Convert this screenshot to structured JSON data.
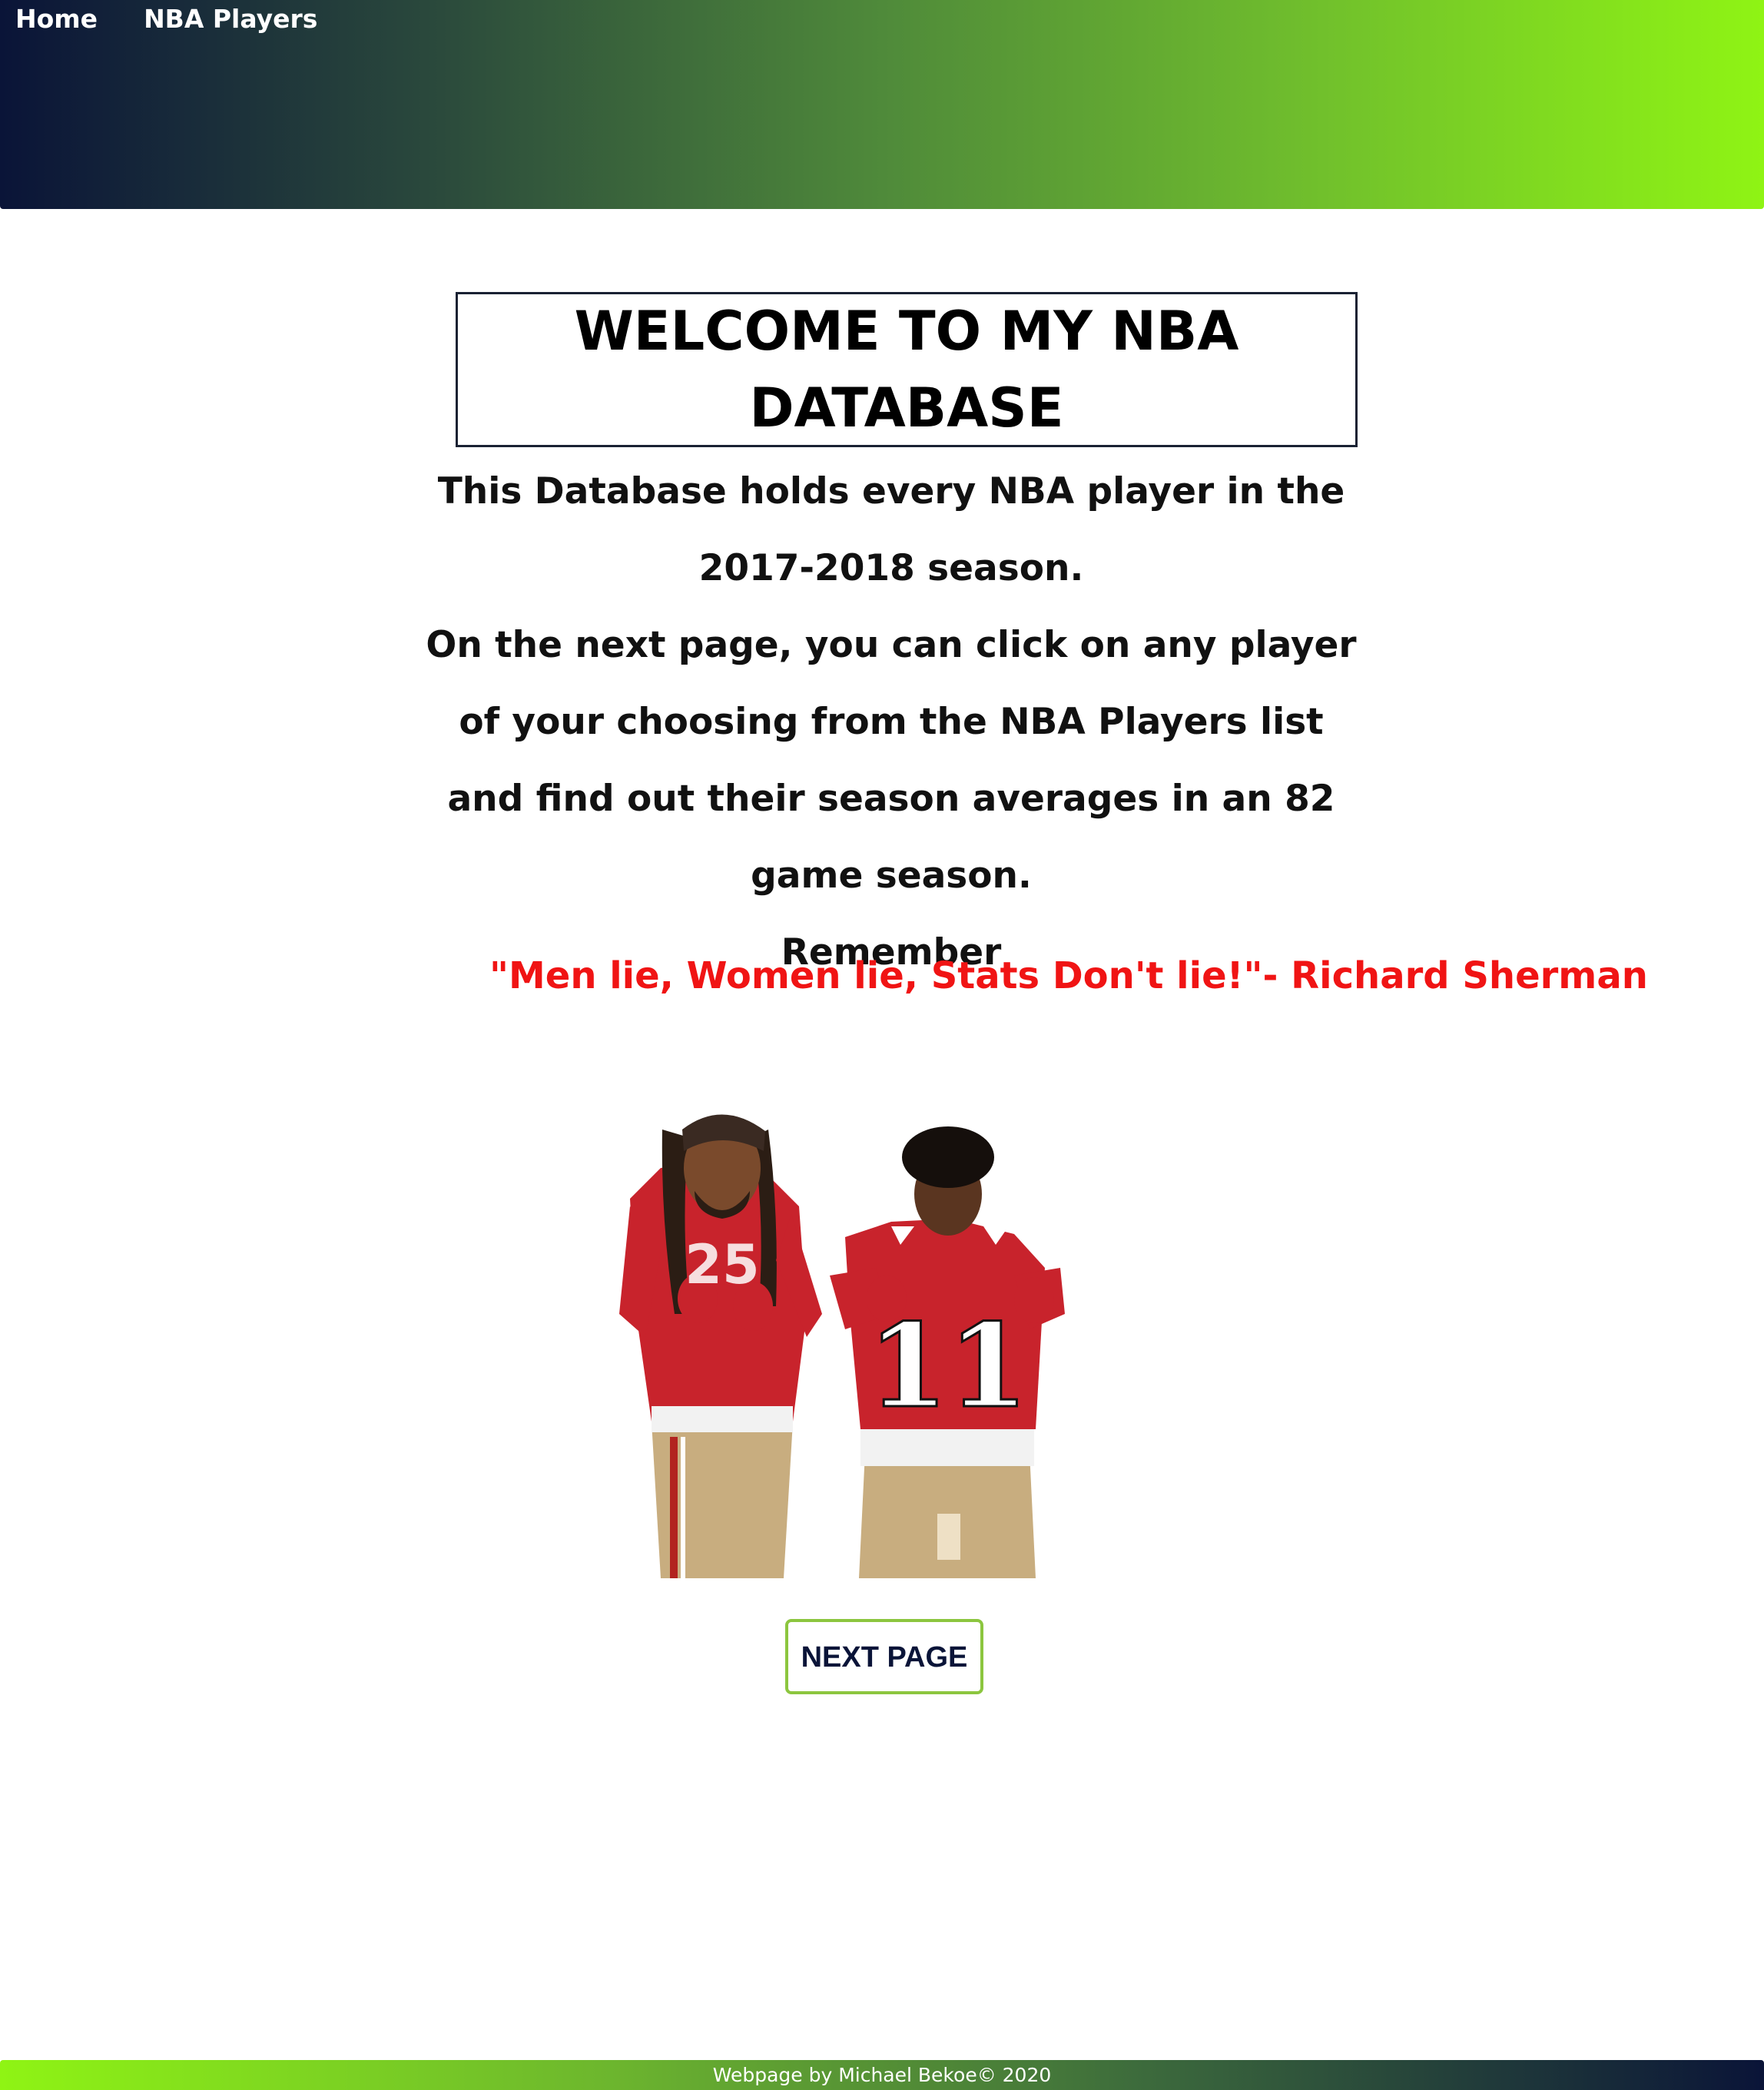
{
  "nav": {
    "home_label": "Home",
    "players_label": "NBA Players"
  },
  "main": {
    "title": "WELCOME TO MY NBA DATABASE",
    "intro_line_1": "This Database holds every NBA player in the 2017-2018 season.",
    "intro_line_2": "On the next page, you can click on any player of your choosing from the NBA Players list and find out their season averages in an 82 game season.",
    "intro_line_3": "Remember",
    "quote": "\"Men lie, Women lie, Stats Don't lie!\"- Richard Sherman",
    "next_button_label": "NEXT PAGE"
  },
  "image": {
    "jersey_number": "11"
  },
  "footer": {
    "credit": "Webpage by Michael Bekoe© 2020"
  },
  "colors": {
    "header_gradient_start": "#0a1438",
    "header_gradient_end": "#8ff414",
    "quote_color": "#f01414",
    "button_border": "#8cc63f",
    "button_text": "#0a1438"
  }
}
